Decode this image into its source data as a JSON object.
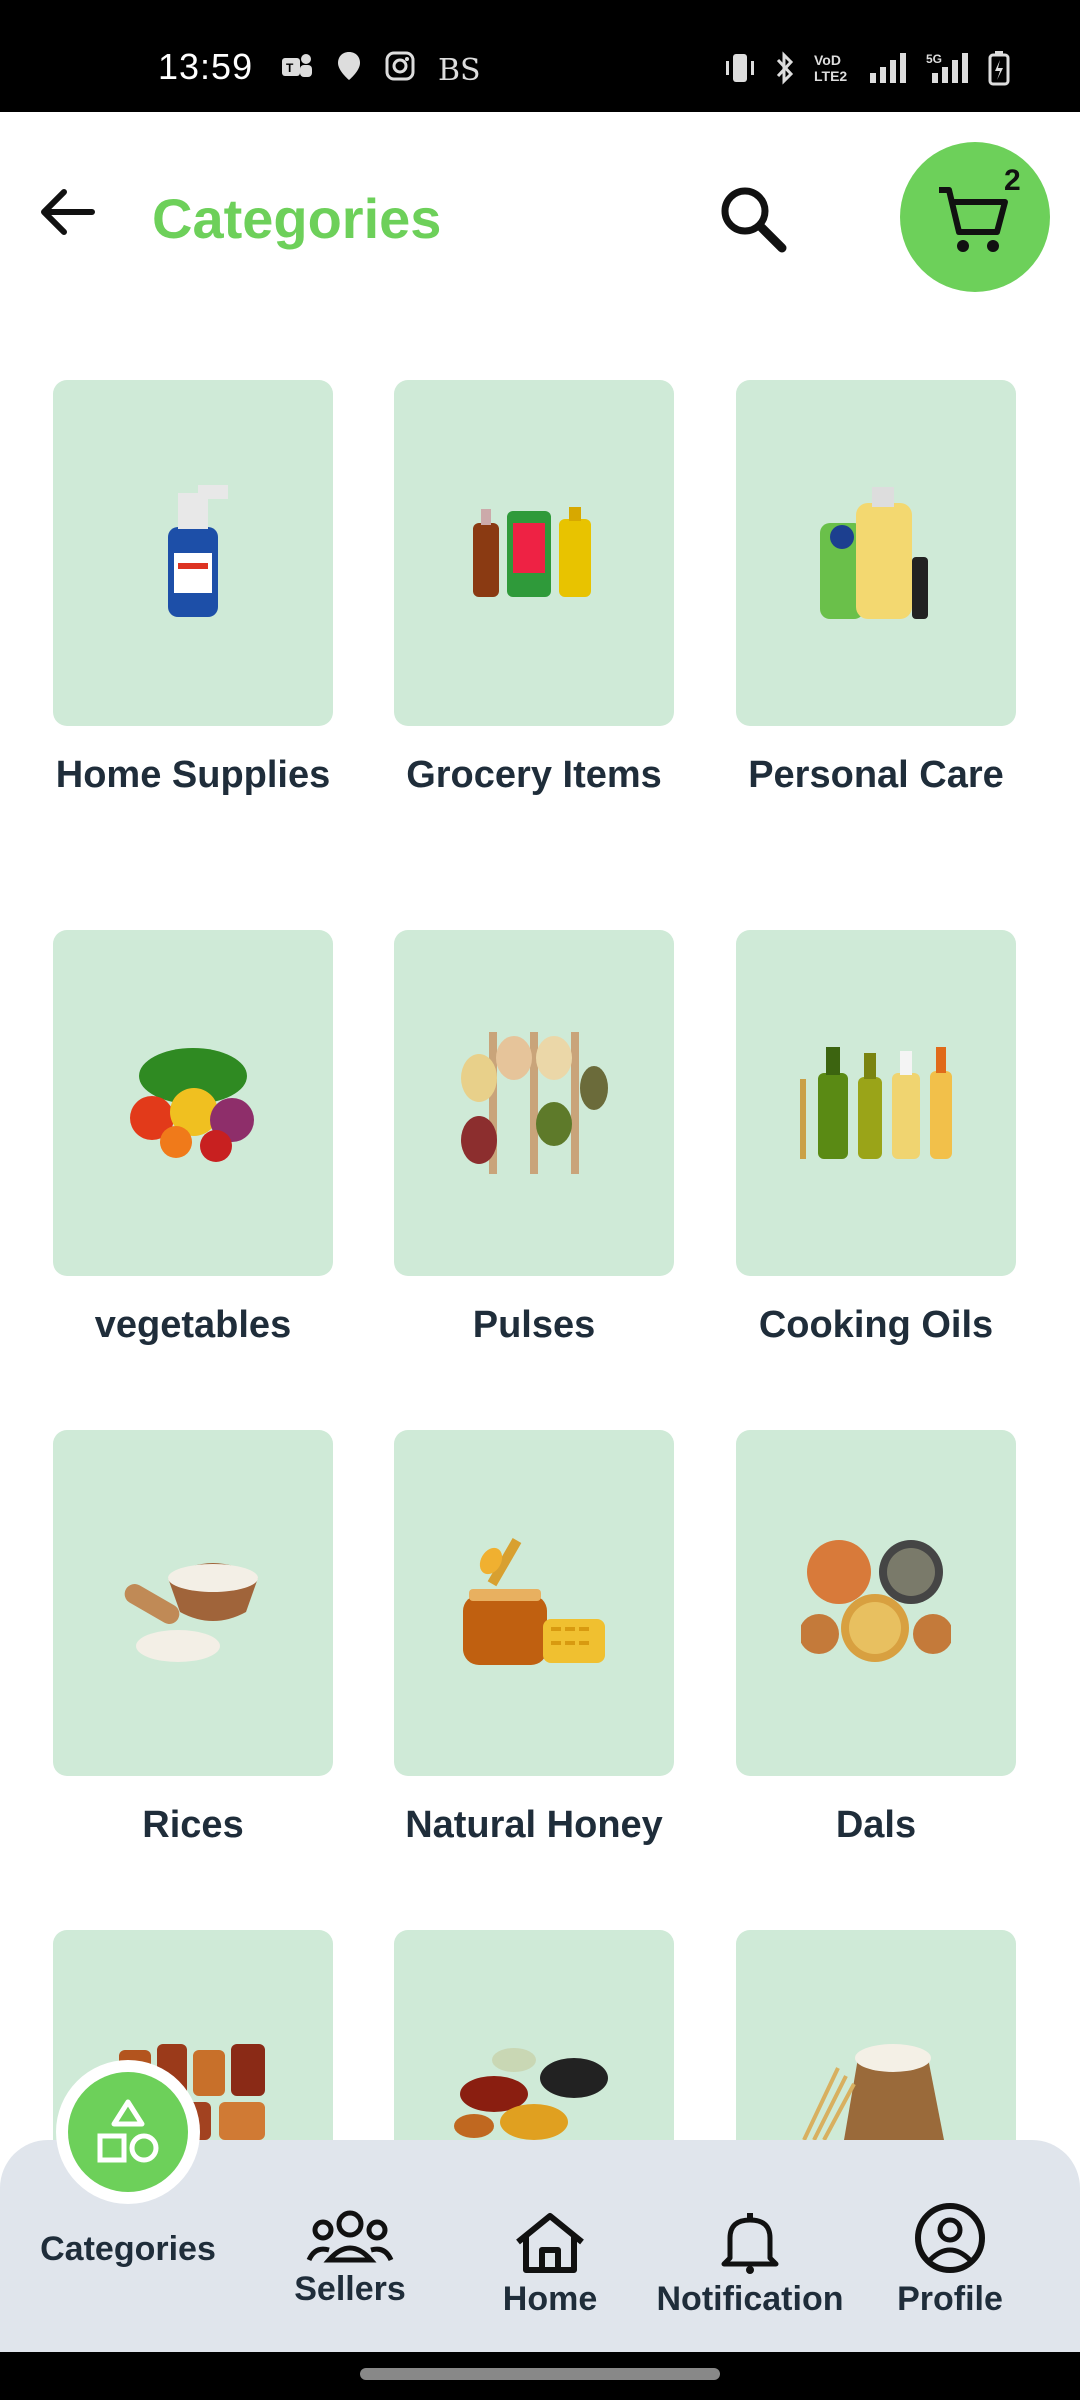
{
  "status_bar": {
    "time": "13:59",
    "left_icons": [
      "teams-icon",
      "location-icon",
      "instagram-icon",
      "bs-icon"
    ],
    "bs_text": "BS",
    "right_icons": [
      "vibrate-icon",
      "bluetooth-icon",
      "volte-icon",
      "signal-icon",
      "5g-signal-icon",
      "battery-icon"
    ]
  },
  "header": {
    "title": "Categories",
    "cart_count": "2"
  },
  "categories": [
    {
      "label": "Home Supplies"
    },
    {
      "label": "Grocery Items"
    },
    {
      "label": "Personal Care"
    },
    {
      "label": "vegetables"
    },
    {
      "label": "Pulses"
    },
    {
      "label": "Cooking Oils"
    },
    {
      "label": "Rices"
    },
    {
      "label": "Natural Honey"
    },
    {
      "label": "Dals"
    },
    {
      "label": ""
    },
    {
      "label": ""
    },
    {
      "label": ""
    }
  ],
  "bottom_nav": {
    "categories": "Categories",
    "sellers": "Sellers",
    "home": "Home",
    "notification": "Notification",
    "profile": "Profile"
  },
  "colors": {
    "accent": "#6dd05a",
    "tile_bg": "#cfead7",
    "nav_bg": "#e0e5ec"
  }
}
